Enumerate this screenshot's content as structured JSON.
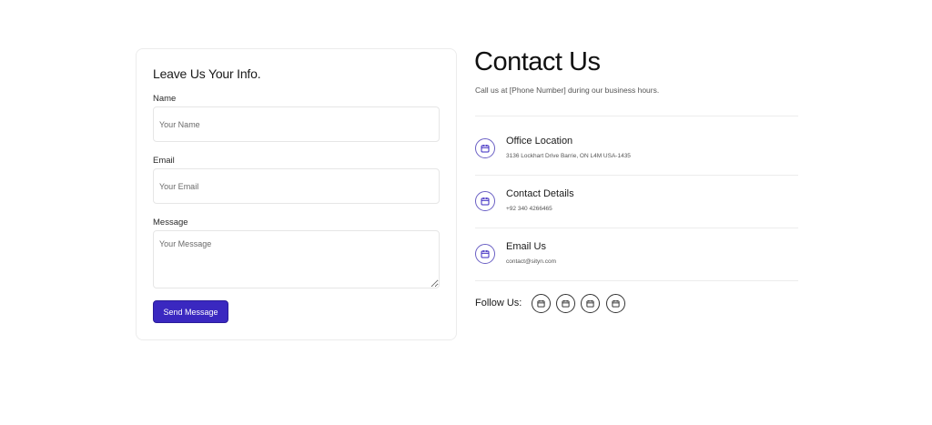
{
  "form": {
    "title": "Leave Us Your Info.",
    "name_label": "Name",
    "name_placeholder": "Your Name",
    "email_label": "Email",
    "email_placeholder": "Your Email",
    "message_label": "Message",
    "message_placeholder": "Your Message",
    "submit_label": "Send Message"
  },
  "contact": {
    "heading": "Contact Us",
    "subtitle": "Call us at [Phone Number] during our business hours.",
    "items": [
      {
        "title": "Office Location",
        "value": "3136 Lockhart Drive Barrie, ON L4M USA-1435",
        "icon": "calendar-icon"
      },
      {
        "title": "Contact Details",
        "value": "+92 340 4266465",
        "icon": "calendar-icon"
      },
      {
        "title": "Email Us",
        "value": "contact@sityn.com",
        "icon": "calendar-icon"
      }
    ],
    "follow_label": "Follow Us:",
    "social_icons": [
      "calendar-icon",
      "calendar-icon",
      "calendar-icon",
      "calendar-icon"
    ]
  },
  "colors": {
    "accent": "#3a28c0",
    "icon_accent": "#6a5fc4",
    "border": "#ececec"
  }
}
